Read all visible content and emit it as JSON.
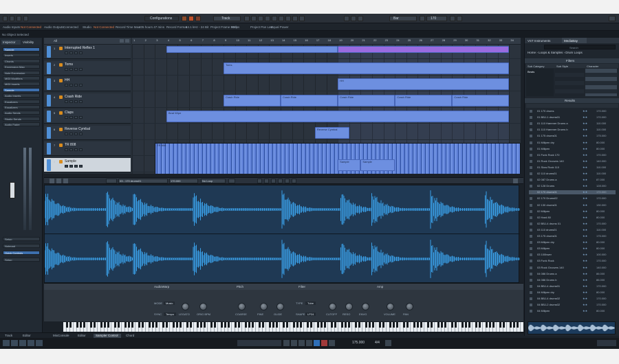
{
  "toolbar": {
    "window_title": "Configurations",
    "track_label": "Track",
    "bar_label": "Bar",
    "tempo_value": "170"
  },
  "status_bar": {
    "items": [
      "Audio Inputs",
      "Not Connected",
      "Audio Outputs",
      "Connected",
      "Studio",
      "Not Connected",
      "Record Time Max",
      "405 hours 47 mins",
      "Record Format",
      "44.1 kHz - 24 Bit",
      "Project Frame Rate",
      "30 fps",
      "Project Pan Law",
      "Equal Power"
    ]
  },
  "no_object": "No Object Selected",
  "inspector": {
    "tabs": [
      "Inspector",
      "Visibility"
    ],
    "rows": [
      {
        "label": "Sample",
        "active": true
      },
      {
        "label": "Inserts",
        "active": false
      },
      {
        "label": "Chords",
        "active": false
      },
      {
        "label": "Expression Map",
        "active": false
      },
      {
        "label": "Note Expression",
        "active": false
      },
      {
        "label": "MIDI Modifiers",
        "active": false
      },
      {
        "label": "MIDI Inserts",
        "active": false
      },
      {
        "label": "Sample",
        "active": true
      },
      {
        "label": "Audio Inserts",
        "active": false
      },
      {
        "label": "Equalizers",
        "active": false
      },
      {
        "label": "Equalizers",
        "active": false
      },
      {
        "label": "Audio Sends",
        "active": false
      },
      {
        "label": "Studio Sends",
        "active": false
      },
      {
        "label": "Audio Fader",
        "active": false
      }
    ],
    "bottom": [
      "Setup",
      "Notepad",
      "Quick Controls",
      "Setup"
    ]
  },
  "tracks": {
    "header": "All",
    "first_track": "Interrupted Reflex 1",
    "rows": [
      {
        "num": "1",
        "name": "Interrupted Reflex 1",
        "color": "#4f8fd6"
      },
      {
        "num": "2",
        "name": "Toms",
        "color": "#4f8fd6"
      },
      {
        "num": "3",
        "name": "HH",
        "color": "#4f8fd6"
      },
      {
        "num": "4",
        "name": "Crash Ride",
        "color": "#4f8fd6"
      },
      {
        "num": "5",
        "name": "Claps",
        "color": "#4f8fd6"
      },
      {
        "num": "6",
        "name": "Reverse Cymbal",
        "color": "#4f8fd6"
      },
      {
        "num": "7",
        "name": "TR 808",
        "color": "#4f8fd6"
      },
      {
        "num": "8",
        "name": "Sample",
        "color": "#4f8fd6"
      }
    ]
  },
  "ruler": {
    "marks": [
      "1",
      "2",
      "3",
      "4",
      "5",
      "6",
      "7",
      "8",
      "9",
      "10",
      "11",
      "12",
      "13",
      "14",
      "15",
      "16",
      "17",
      "18",
      "19",
      "20",
      "21",
      "22",
      "23",
      "24",
      "25",
      "26",
      "27",
      "28",
      "29",
      "30",
      "31",
      "32",
      "33",
      "34",
      "35"
    ]
  },
  "events": [
    {
      "track": 0,
      "label": "",
      "start": 3,
      "len": 15
    },
    {
      "track": 0,
      "label": "",
      "start": 18,
      "len": 15,
      "selected": true
    },
    {
      "track": 1,
      "label": "Toms",
      "start": 8,
      "len": 25
    },
    {
      "track": 2,
      "label": "HH",
      "start": 18,
      "len": 15
    },
    {
      "track": 3,
      "label": "Crash Ride",
      "start": 8,
      "len": 5
    },
    {
      "track": 3,
      "label": "Crash Ride",
      "start": 13,
      "len": 5
    },
    {
      "track": 3,
      "label": "Crash Ride",
      "start": 18,
      "len": 5
    },
    {
      "track": 3,
      "label": "Crash Ride",
      "start": 23,
      "len": 5
    },
    {
      "track": 3,
      "label": "Crash Ride",
      "start": 28,
      "len": 5
    },
    {
      "track": 4,
      "label": "Beat Wipe",
      "start": 3,
      "len": 30
    },
    {
      "track": 5,
      "label": "Reverse Cymbal",
      "start": 16,
      "len": 3
    },
    {
      "track": 6,
      "label": "TR 808",
      "start": 2,
      "len": 32,
      "wave": true
    },
    {
      "track": 7,
      "label": "Sample",
      "start": 18,
      "len": 2
    },
    {
      "track": 7,
      "label": "Sample",
      "start": 20,
      "len": 3
    }
  ],
  "editor": {
    "toolbar_items": [
      "",
      "03 - 170 drums01",
      "170.000",
      "No Loop",
      ""
    ]
  },
  "sampler": {
    "sections": [
      "AudioWarp",
      "Pitch",
      "Filter",
      "Amp"
    ],
    "knobs": [
      {
        "label": "MODE",
        "value": "Music"
      },
      {
        "label": "SYNC",
        "value": "Tempo"
      },
      {
        "label": "LEGATO"
      },
      {
        "label": "ORIG BPM"
      },
      {
        "label": "COARSE"
      },
      {
        "label": "FINE"
      },
      {
        "label": "GLIDE"
      },
      {
        "label": "TYPE",
        "value": "Tube"
      },
      {
        "label": "SHAPE",
        "value": "LP24"
      },
      {
        "label": "CUTOFF"
      },
      {
        "label": "RESO"
      },
      {
        "label": "ENVG"
      },
      {
        "label": "VOLUME"
      },
      {
        "label": "PAN"
      }
    ]
  },
  "bottom_tabs": [
    "Track",
    "Editor",
    "MixConsole",
    "Editor",
    "Sampler Control",
    "Chord Pads"
  ],
  "transport": {
    "position": "175.000",
    "signature": "4/4"
  },
  "vst": {
    "tabs": [
      "VST Instruments",
      "MediaBay"
    ],
    "search_placeholder": "Search",
    "breadcrumb": [
      "Home",
      "Loops & Samples",
      "Drum Loops"
    ],
    "filters_title": "Filters",
    "filter_columns": [
      "Sub Category",
      "Sub Style",
      "Character"
    ],
    "filter_category": "Beats",
    "results_title": "Results",
    "results": [
      {
        "name": "01 170 drums",
        "stars": "★★",
        "tempo": "170.000"
      },
      {
        "name": "01 BBJ-1 drums01",
        "stars": "★★",
        "tempo": "170.000"
      },
      {
        "name": "01 110 Hammer Drums a",
        "stars": "★★",
        "tempo": "110.000"
      },
      {
        "name": "01 110 Hammer Drums b",
        "stars": "★★",
        "tempo": "110.000"
      },
      {
        "name": "01 175 drums01",
        "stars": "★★",
        "tempo": "175.000"
      },
      {
        "name": "01 Millpen dry",
        "stars": "★★",
        "tempo": "80.000"
      },
      {
        "name": "01 Millpen",
        "stars": "★★",
        "tempo": "80.000"
      },
      {
        "name": "01 Funk Rock 170",
        "stars": "★★",
        "tempo": "170.000"
      },
      {
        "name": "01 Rock Grooves 140",
        "stars": "★★",
        "tempo": "140.000"
      },
      {
        "name": "01 Slow Rock 110",
        "stars": "★★",
        "tempo": "110.000"
      },
      {
        "name": "02 110 drums01",
        "stars": "★★",
        "tempo": "110.000"
      },
      {
        "name": "02 087 Drums a",
        "stars": "★★",
        "tempo": "87.000"
      },
      {
        "name": "02 128 Drums",
        "stars": "★★",
        "tempo": "128.000"
      },
      {
        "name": "02 170 drums01",
        "stars": "★★",
        "tempo": "170.000",
        "highlight": true
      },
      {
        "name": "02 170 Drums02",
        "stars": "★★",
        "tempo": "170.000"
      },
      {
        "name": "02 130 drums01",
        "stars": "★★",
        "tempo": "130.000"
      },
      {
        "name": "02 Millpen",
        "stars": "★★",
        "tempo": "80.000"
      },
      {
        "name": "02 Hard 80",
        "stars": "★★",
        "tempo": "80.000"
      },
      {
        "name": "02 BBJ-4 drums 01",
        "stars": "★★",
        "tempo": "170.000"
      },
      {
        "name": "03 110 drums01",
        "stars": "★★",
        "tempo": "110.000"
      },
      {
        "name": "03 175 drums01",
        "stars": "★★",
        "tempo": "175.000"
      },
      {
        "name": "03 Millpen dry",
        "stars": "★★",
        "tempo": "80.000"
      },
      {
        "name": "03 Millpen",
        "stars": "★★",
        "tempo": "80.000"
      },
      {
        "name": "03 100bwer",
        "stars": "★★",
        "tempo": "100.000"
      },
      {
        "name": "03 Funk Rock",
        "stars": "★★",
        "tempo": "170.000"
      },
      {
        "name": "03 Rock Grooves 140",
        "stars": "★★",
        "tempo": "140.000"
      },
      {
        "name": "04 086 Drums a",
        "stars": "★★",
        "tempo": "86.000"
      },
      {
        "name": "04 086 Drums b",
        "stars": "★★",
        "tempo": "86.000"
      },
      {
        "name": "04 BBJ-4 drums01",
        "stars": "★★",
        "tempo": "170.000"
      },
      {
        "name": "04 Millpen dry",
        "stars": "★★",
        "tempo": "80.000"
      },
      {
        "name": "04 BBJ-4 drums02",
        "stars": "★★",
        "tempo": "170.000"
      },
      {
        "name": "04 BBJ-2 drums02",
        "stars": "★★",
        "tempo": "170.000"
      },
      {
        "name": "04 Millpen",
        "stars": "★★",
        "tempo": "80.000"
      }
    ]
  },
  "colors": {
    "accent": "#3d6fae",
    "event": "#6d8fe0",
    "waveform": "#3aa0e8",
    "highlight_event": "#9a6be0"
  }
}
